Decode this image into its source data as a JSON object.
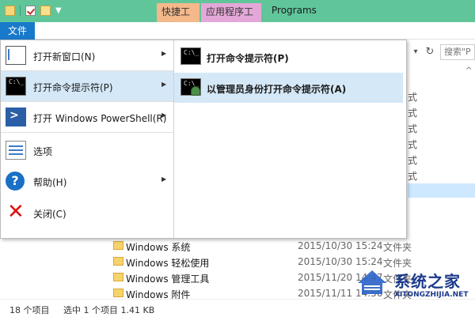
{
  "titlebar": {
    "context_quick": "快捷工具",
    "context_app": "应用程序工具",
    "title": "Programs"
  },
  "ribbon": {
    "file_tab": "文件"
  },
  "search": {
    "placeholder": "搜索\"P"
  },
  "file_menu": {
    "items": [
      {
        "label": "打开新窗口(N)",
        "icon": "new-window-icon",
        "has_submenu": true
      },
      {
        "label": "打开命令提示符(P)",
        "icon": "command-prompt-icon",
        "has_submenu": true
      },
      {
        "label": "打开 Windows PowerShell(R)",
        "icon": "powershell-icon",
        "has_submenu": true
      },
      {
        "label": "选项",
        "icon": "options-icon",
        "has_submenu": false
      },
      {
        "label": "帮助(H)",
        "icon": "help-icon",
        "has_submenu": true
      },
      {
        "label": "关闭(C)",
        "icon": "close-icon",
        "has_submenu": false
      }
    ],
    "submenu": [
      {
        "label": "打开命令提示符(P)",
        "icon": "command-prompt-icon"
      },
      {
        "label": "以管理员身份打开命令提示符(A)",
        "icon": "admin-command-prompt-icon"
      }
    ]
  },
  "background_types": [
    "式",
    "式",
    "式",
    "式",
    "式",
    "式"
  ],
  "files": [
    {
      "name": "Windows 系统",
      "date": "2015/10/30 15:24",
      "type": "文件夹"
    },
    {
      "name": "Windows 轻松使用",
      "date": "2015/10/30 15:24",
      "type": "文件夹"
    },
    {
      "name": "Windows 管理工具",
      "date": "2015/11/20 14:47",
      "type": "文件夹"
    },
    {
      "name": "Windows 附件",
      "date": "2015/11/11 14:50",
      "type": "文件夹"
    }
  ],
  "status": {
    "count": "18 个项目",
    "selection": "选中 1 个项目  1.41 KB"
  },
  "watermark": {
    "text": "系统之家",
    "sub": "XITONGZHIJIA.NET"
  }
}
